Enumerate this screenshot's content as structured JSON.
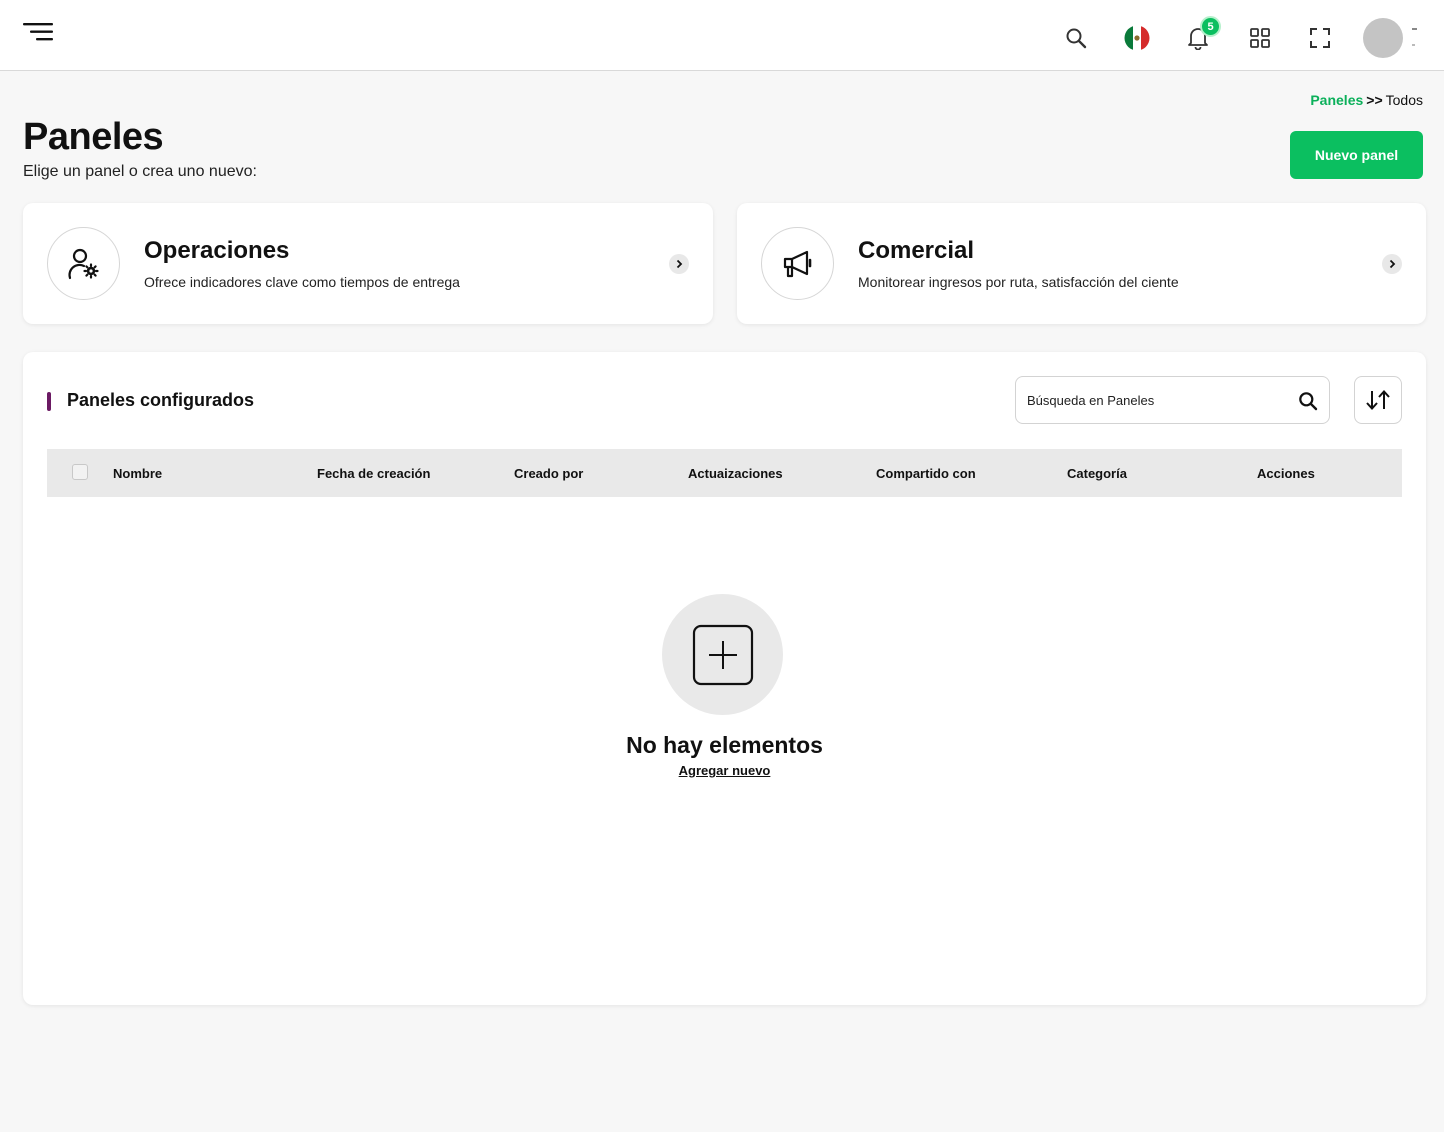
{
  "header": {
    "notification_count": "5",
    "icons": [
      "menu-icon",
      "search-icon",
      "mexico-flag-icon",
      "bell-icon",
      "apps-grid-icon",
      "fullscreen-icon",
      "avatar"
    ]
  },
  "breadcrumb": {
    "link": "Paneles",
    "separator": ">>",
    "current": "Todos"
  },
  "page": {
    "title": "Paneles",
    "subtitle": "Elige un panel o crea uno nuevo:",
    "new_button": "Nuevo panel"
  },
  "cards": [
    {
      "title": "Operaciones",
      "description": "Ofrece indicadores clave como tiempos de entrega",
      "icon": "user-gear-icon"
    },
    {
      "title": "Comercial",
      "description": "Monitorear ingresos por ruta, satisfacción del ciente",
      "icon": "megaphone-icon"
    }
  ],
  "configured": {
    "title": "Paneles configurados",
    "search_placeholder": "Búsqueda en Paneles",
    "columns": [
      "Nombre",
      "Fecha de creación",
      "Creado por",
      "Actuaizaciones",
      "Compartido con",
      "Categoría",
      "Acciones"
    ],
    "rows": [],
    "empty_title": "No hay elementos",
    "empty_link": "Agregar nuevo"
  },
  "colors": {
    "accent_green": "#0bbf60",
    "section_marker": "#6b1a63"
  }
}
